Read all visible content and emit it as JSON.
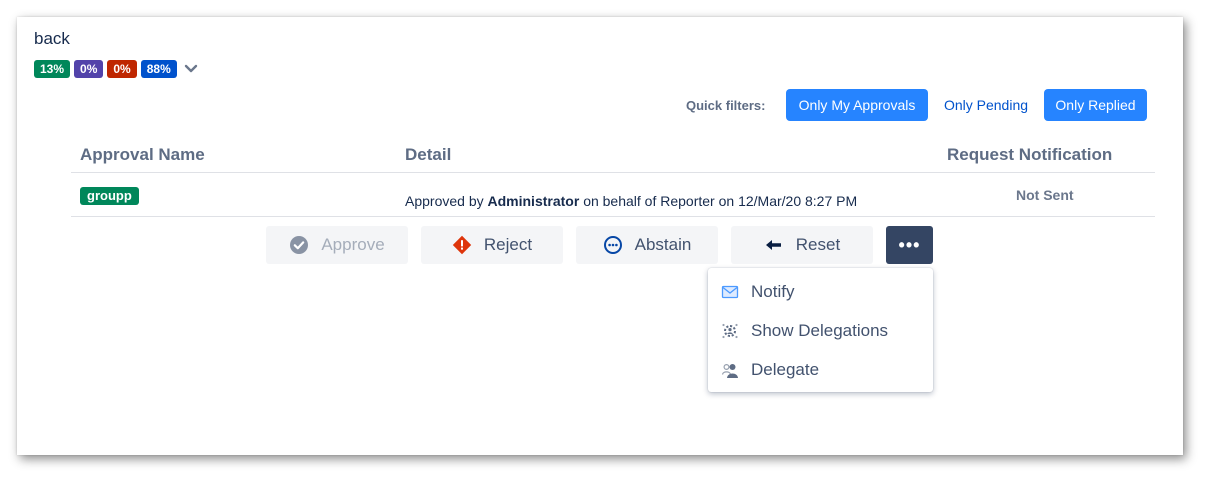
{
  "back_link": "back",
  "badges": [
    {
      "label": "13%",
      "color": "#00875a"
    },
    {
      "label": "0%",
      "color": "#5243aa"
    },
    {
      "label": "0%",
      "color": "#bf2600"
    },
    {
      "label": "88%",
      "color": "#0052cc"
    }
  ],
  "quick_filters": {
    "label": "Quick filters:",
    "items": [
      {
        "label": "Only My Approvals",
        "active": true
      },
      {
        "label": "Only Pending",
        "active": false
      },
      {
        "label": "Only Replied",
        "active": true
      }
    ]
  },
  "table": {
    "headers": [
      "Approval Name",
      "Detail",
      "Request Notification"
    ],
    "row": {
      "name": "groupp",
      "detail_prefix": "Approved by",
      "detail_user": "Administrator",
      "detail_suffix": "on behalf of Reporter on 12/Mar/20 8:27 PM",
      "notification": "Not Sent"
    }
  },
  "actions": {
    "approve": "Approve",
    "reject": "Reject",
    "abstain": "Abstain",
    "reset": "Reset",
    "more": "•••"
  },
  "more_menu": {
    "notify": "Notify",
    "show_delegations": "Show Delegations",
    "delegate": "Delegate"
  },
  "icons": {
    "approve": "check-circle-icon",
    "reject": "error-diamond-icon",
    "abstain": "ellipsis-circle-icon",
    "reset": "arrow-left-icon",
    "notify": "envelope-icon",
    "show_delegations": "gear-people-icon",
    "delegate": "person-icon",
    "expand": "chevron-down-icon"
  }
}
